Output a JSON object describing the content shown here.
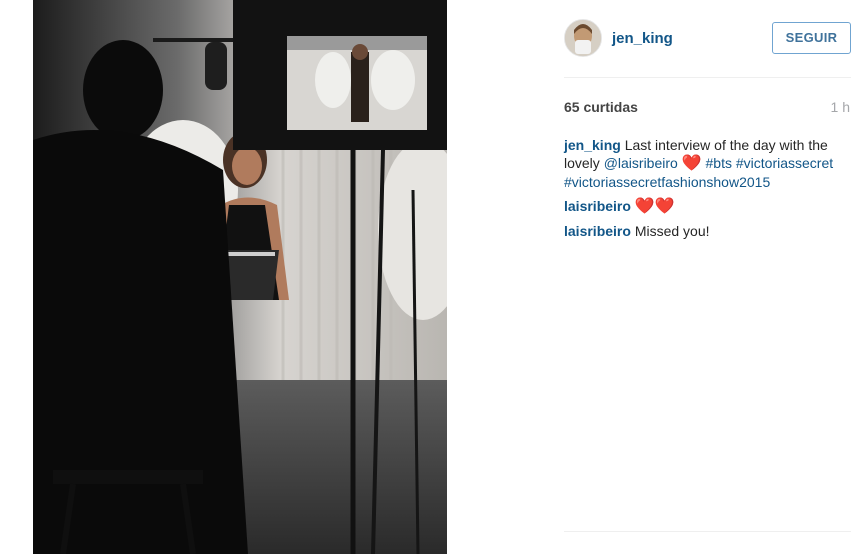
{
  "post": {
    "photo_alt": "Behind-the-scenes interview photo",
    "author": {
      "username": "jen_king",
      "follow_label": "SEGUIR"
    },
    "likes_label": "65 curtidas",
    "time_ago": "1 h",
    "caption": {
      "username": "jen_king",
      "text_1": "Last interview of the day with the lovely ",
      "mention": "@laisribeiro",
      "heart": "❤️",
      "tag_1": "#bts",
      "tag_2": "#victoriassecret",
      "tag_3": "#victoriassecretfashionshow2015"
    },
    "comments": [
      {
        "username": "laisribeiro",
        "text": "❤️❤️"
      },
      {
        "username": "laisribeiro",
        "text": "Missed you!"
      }
    ]
  },
  "colors": {
    "link": "#125688",
    "follow_border": "#70a4d1",
    "heart": "#e0242b"
  }
}
